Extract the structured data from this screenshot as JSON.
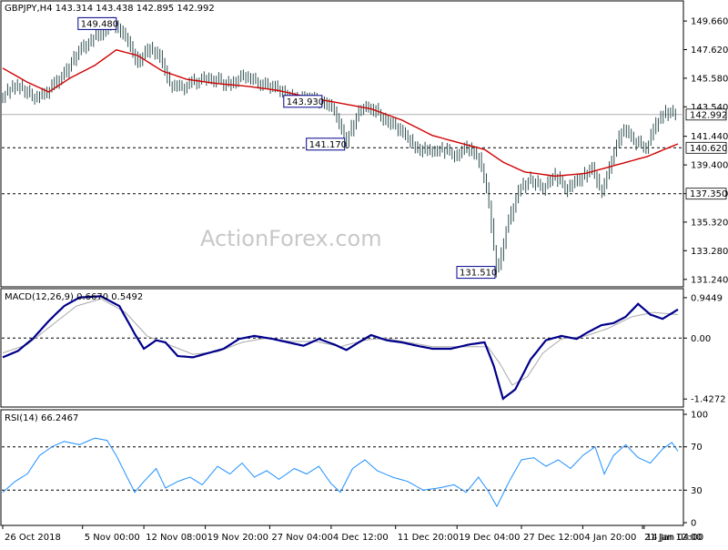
{
  "header": {
    "symbol_line": "GBPJPY,H4  143.314 143.438 142.895 142.992",
    "watermark": "ActionForex.com"
  },
  "chart_data": [
    {
      "type": "candlestick",
      "panel": "price",
      "title": "GBPJPY,H4  143.314 143.438 142.895 142.992",
      "ylim": [
        130.9,
        150.9
      ],
      "y_ticks": [
        "149.660",
        "147.620",
        "145.580",
        "143.540",
        "141.440",
        "139.400",
        "137.350",
        "135.320",
        "133.280",
        "131.240"
      ],
      "last_price_label": "142.992",
      "price_path": [
        {
          "t": 0,
          "v": 144.4
        },
        {
          "t": 5,
          "v": 145.1
        },
        {
          "t": 10,
          "v": 144.2
        },
        {
          "t": 15,
          "v": 144.7
        },
        {
          "t": 20,
          "v": 145.9
        },
        {
          "t": 25,
          "v": 147.6
        },
        {
          "t": 29,
          "v": 148.4
        },
        {
          "t": 33,
          "v": 149.0
        },
        {
          "t": 37,
          "v": 149.48
        },
        {
          "t": 41,
          "v": 148.2
        },
        {
          "t": 44,
          "v": 146.6
        },
        {
          "t": 48,
          "v": 147.8
        },
        {
          "t": 51,
          "v": 147.2
        },
        {
          "t": 54,
          "v": 145.2
        },
        {
          "t": 58,
          "v": 144.9
        },
        {
          "t": 63,
          "v": 145.4
        },
        {
          "t": 68,
          "v": 145.6
        },
        {
          "t": 73,
          "v": 145.1
        },
        {
          "t": 78,
          "v": 145.7
        },
        {
          "t": 83,
          "v": 145.3
        },
        {
          "t": 88,
          "v": 145.0
        },
        {
          "t": 92,
          "v": 144.6
        },
        {
          "t": 96,
          "v": 143.9
        },
        {
          "t": 100,
          "v": 144.3
        },
        {
          "t": 104,
          "v": 143.93
        },
        {
          "t": 108,
          "v": 143.2
        },
        {
          "t": 112,
          "v": 141.17
        },
        {
          "t": 116,
          "v": 143.3
        },
        {
          "t": 120,
          "v": 143.5
        },
        {
          "t": 124,
          "v": 142.8
        },
        {
          "t": 128,
          "v": 142.1
        },
        {
          "t": 133,
          "v": 141.0
        },
        {
          "t": 138,
          "v": 140.3
        },
        {
          "t": 143,
          "v": 140.5
        },
        {
          "t": 148,
          "v": 140.0
        },
        {
          "t": 152,
          "v": 140.7
        },
        {
          "t": 155,
          "v": 139.9
        },
        {
          "t": 158,
          "v": 137.4
        },
        {
          "t": 161,
          "v": 131.51
        },
        {
          "t": 164,
          "v": 134.8
        },
        {
          "t": 168,
          "v": 137.6
        },
        {
          "t": 172,
          "v": 138.4
        },
        {
          "t": 176,
          "v": 137.8
        },
        {
          "t": 180,
          "v": 138.6
        },
        {
          "t": 184,
          "v": 137.7
        },
        {
          "t": 188,
          "v": 138.4
        },
        {
          "t": 192,
          "v": 139.2
        },
        {
          "t": 195,
          "v": 137.5
        },
        {
          "t": 199,
          "v": 140.2
        },
        {
          "t": 202,
          "v": 142.0
        },
        {
          "t": 206,
          "v": 141.0
        },
        {
          "t": 210,
          "v": 140.7
        },
        {
          "t": 213,
          "v": 142.4
        },
        {
          "t": 217,
          "v": 143.3
        },
        {
          "t": 220,
          "v": 142.99
        }
      ],
      "ma_path": [
        {
          "t": 0,
          "v": 146.3
        },
        {
          "t": 8,
          "v": 145.3
        },
        {
          "t": 15,
          "v": 144.6
        },
        {
          "t": 22,
          "v": 145.6
        },
        {
          "t": 30,
          "v": 146.5
        },
        {
          "t": 37,
          "v": 147.6
        },
        {
          "t": 44,
          "v": 147.2
        },
        {
          "t": 52,
          "v": 146.1
        },
        {
          "t": 60,
          "v": 145.5
        },
        {
          "t": 70,
          "v": 145.2
        },
        {
          "t": 80,
          "v": 145.0
        },
        {
          "t": 90,
          "v": 144.7
        },
        {
          "t": 100,
          "v": 144.2
        },
        {
          "t": 110,
          "v": 143.8
        },
        {
          "t": 120,
          "v": 143.4
        },
        {
          "t": 130,
          "v": 142.6
        },
        {
          "t": 140,
          "v": 141.5
        },
        {
          "t": 150,
          "v": 140.9
        },
        {
          "t": 157,
          "v": 140.5
        },
        {
          "t": 163,
          "v": 139.6
        },
        {
          "t": 170,
          "v": 138.9
        },
        {
          "t": 180,
          "v": 138.6
        },
        {
          "t": 190,
          "v": 138.8
        },
        {
          "t": 200,
          "v": 139.4
        },
        {
          "t": 210,
          "v": 140.0
        },
        {
          "t": 220,
          "v": 140.9
        }
      ],
      "h_levels": [
        {
          "label": "140.620",
          "value": 140.62,
          "style": "dashed",
          "boxed": true
        },
        {
          "label": "137.350",
          "value": 137.35,
          "style": "dashed",
          "boxed": true
        },
        {
          "label": "",
          "value": 142.99,
          "style": "solid-light",
          "boxed": false
        }
      ],
      "annotations": [
        {
          "label": "149.480",
          "t": 37,
          "v": 149.48,
          "place": "left"
        },
        {
          "label": "143.930",
          "t": 104,
          "v": 143.93,
          "place": "left"
        },
        {
          "label": "141.170",
          "t": 112,
          "v": 141.17,
          "place": "left-below"
        },
        {
          "label": "131.510",
          "t": 161,
          "v": 131.51,
          "place": "left-below"
        }
      ]
    },
    {
      "type": "line",
      "panel": "macd",
      "title": "MACD(12,26,9) 0.6670 0.5492",
      "ylim": [
        -1.55,
        1.05
      ],
      "y_ticks": [
        "0.9449",
        "0.00",
        "-1.4272"
      ],
      "macd_path": [
        {
          "t": 0,
          "v": -0.45
        },
        {
          "t": 5,
          "v": -0.3
        },
        {
          "t": 10,
          "v": 0.0
        },
        {
          "t": 15,
          "v": 0.4
        },
        {
          "t": 20,
          "v": 0.75
        },
        {
          "t": 25,
          "v": 0.95
        },
        {
          "t": 32,
          "v": 0.98
        },
        {
          "t": 38,
          "v": 0.75
        },
        {
          "t": 43,
          "v": 0.1
        },
        {
          "t": 46,
          "v": -0.25
        },
        {
          "t": 50,
          "v": -0.05
        },
        {
          "t": 53,
          "v": -0.1
        },
        {
          "t": 57,
          "v": -0.42
        },
        {
          "t": 62,
          "v": -0.45
        },
        {
          "t": 67,
          "v": -0.35
        },
        {
          "t": 72,
          "v": -0.25
        },
        {
          "t": 77,
          "v": -0.02
        },
        {
          "t": 82,
          "v": 0.05
        },
        {
          "t": 88,
          "v": -0.02
        },
        {
          "t": 93,
          "v": -0.1
        },
        {
          "t": 98,
          "v": -0.18
        },
        {
          "t": 103,
          "v": -0.02
        },
        {
          "t": 108,
          "v": -0.15
        },
        {
          "t": 112,
          "v": -0.28
        },
        {
          "t": 116,
          "v": -0.1
        },
        {
          "t": 120,
          "v": 0.07
        },
        {
          "t": 125,
          "v": -0.05
        },
        {
          "t": 130,
          "v": -0.1
        },
        {
          "t": 135,
          "v": -0.18
        },
        {
          "t": 140,
          "v": -0.25
        },
        {
          "t": 146,
          "v": -0.25
        },
        {
          "t": 152,
          "v": -0.15
        },
        {
          "t": 157,
          "v": -0.1
        },
        {
          "t": 160,
          "v": -0.65
        },
        {
          "t": 163,
          "v": -1.42
        },
        {
          "t": 167,
          "v": -1.2
        },
        {
          "t": 172,
          "v": -0.5
        },
        {
          "t": 177,
          "v": -0.05
        },
        {
          "t": 182,
          "v": 0.05
        },
        {
          "t": 187,
          "v": -0.02
        },
        {
          "t": 191,
          "v": 0.15
        },
        {
          "t": 195,
          "v": 0.3
        },
        {
          "t": 199,
          "v": 0.35
        },
        {
          "t": 203,
          "v": 0.5
        },
        {
          "t": 207,
          "v": 0.8
        },
        {
          "t": 211,
          "v": 0.55
        },
        {
          "t": 215,
          "v": 0.45
        },
        {
          "t": 220,
          "v": 0.67
        }
      ],
      "signal_path": [
        {
          "t": 0,
          "v": -0.35
        },
        {
          "t": 8,
          "v": -0.15
        },
        {
          "t": 16,
          "v": 0.3
        },
        {
          "t": 24,
          "v": 0.75
        },
        {
          "t": 32,
          "v": 0.92
        },
        {
          "t": 40,
          "v": 0.6
        },
        {
          "t": 47,
          "v": 0.05
        },
        {
          "t": 54,
          "v": -0.15
        },
        {
          "t": 62,
          "v": -0.38
        },
        {
          "t": 70,
          "v": -0.32
        },
        {
          "t": 78,
          "v": -0.1
        },
        {
          "t": 86,
          "v": 0.0
        },
        {
          "t": 94,
          "v": -0.08
        },
        {
          "t": 102,
          "v": -0.08
        },
        {
          "t": 110,
          "v": -0.2
        },
        {
          "t": 118,
          "v": -0.05
        },
        {
          "t": 124,
          "v": 0.0
        },
        {
          "t": 132,
          "v": -0.1
        },
        {
          "t": 140,
          "v": -0.2
        },
        {
          "t": 150,
          "v": -0.2
        },
        {
          "t": 158,
          "v": -0.2
        },
        {
          "t": 162,
          "v": -0.6
        },
        {
          "t": 166,
          "v": -1.1
        },
        {
          "t": 171,
          "v": -0.9
        },
        {
          "t": 176,
          "v": -0.35
        },
        {
          "t": 182,
          "v": -0.02
        },
        {
          "t": 190,
          "v": 0.05
        },
        {
          "t": 197,
          "v": 0.22
        },
        {
          "t": 205,
          "v": 0.5
        },
        {
          "t": 212,
          "v": 0.6
        },
        {
          "t": 220,
          "v": 0.55
        }
      ]
    },
    {
      "type": "line",
      "panel": "rsi",
      "title": "RSI(14) 66.2467",
      "ylim": [
        0,
        100
      ],
      "y_ticks": [
        "100",
        "70",
        "30",
        "0"
      ],
      "levels": [
        70,
        30
      ],
      "rsi_path": [
        {
          "t": 0,
          "v": 28
        },
        {
          "t": 4,
          "v": 38
        },
        {
          "t": 8,
          "v": 45
        },
        {
          "t": 12,
          "v": 62
        },
        {
          "t": 16,
          "v": 70
        },
        {
          "t": 20,
          "v": 75
        },
        {
          "t": 25,
          "v": 72
        },
        {
          "t": 30,
          "v": 78
        },
        {
          "t": 34,
          "v": 76
        },
        {
          "t": 37,
          "v": 62
        },
        {
          "t": 40,
          "v": 45
        },
        {
          "t": 43,
          "v": 28
        },
        {
          "t": 46,
          "v": 38
        },
        {
          "t": 50,
          "v": 50
        },
        {
          "t": 53,
          "v": 32
        },
        {
          "t": 57,
          "v": 38
        },
        {
          "t": 61,
          "v": 42
        },
        {
          "t": 65,
          "v": 35
        },
        {
          "t": 70,
          "v": 52
        },
        {
          "t": 74,
          "v": 45
        },
        {
          "t": 78,
          "v": 55
        },
        {
          "t": 82,
          "v": 42
        },
        {
          "t": 86,
          "v": 48
        },
        {
          "t": 90,
          "v": 40
        },
        {
          "t": 95,
          "v": 50
        },
        {
          "t": 99,
          "v": 45
        },
        {
          "t": 103,
          "v": 52
        },
        {
          "t": 107,
          "v": 36
        },
        {
          "t": 110,
          "v": 28
        },
        {
          "t": 114,
          "v": 50
        },
        {
          "t": 118,
          "v": 58
        },
        {
          "t": 122,
          "v": 48
        },
        {
          "t": 127,
          "v": 42
        },
        {
          "t": 132,
          "v": 38
        },
        {
          "t": 137,
          "v": 30
        },
        {
          "t": 142,
          "v": 32
        },
        {
          "t": 147,
          "v": 35
        },
        {
          "t": 151,
          "v": 28
        },
        {
          "t": 155,
          "v": 42
        },
        {
          "t": 158,
          "v": 30
        },
        {
          "t": 161,
          "v": 15
        },
        {
          "t": 165,
          "v": 38
        },
        {
          "t": 169,
          "v": 58
        },
        {
          "t": 173,
          "v": 60
        },
        {
          "t": 177,
          "v": 52
        },
        {
          "t": 181,
          "v": 58
        },
        {
          "t": 185,
          "v": 50
        },
        {
          "t": 189,
          "v": 62
        },
        {
          "t": 193,
          "v": 70
        },
        {
          "t": 196,
          "v": 45
        },
        {
          "t": 199,
          "v": 62
        },
        {
          "t": 203,
          "v": 72
        },
        {
          "t": 207,
          "v": 60
        },
        {
          "t": 211,
          "v": 55
        },
        {
          "t": 215,
          "v": 68
        },
        {
          "t": 218,
          "v": 74
        },
        {
          "t": 220,
          "v": 66
        }
      ]
    }
  ],
  "x_axis": {
    "t_max": 220,
    "labels": [
      {
        "t": 0,
        "text": "26 Oct 2018"
      },
      {
        "t": 26,
        "text": "5 Nov 00:00"
      },
      {
        "t": 46,
        "text": "12 Nov 08:00"
      },
      {
        "t": 66,
        "text": "19 Nov 20:00"
      },
      {
        "t": 87,
        "text": "27 Nov 04:00"
      },
      {
        "t": 107,
        "text": "4 Dec 12:00"
      },
      {
        "t": 128,
        "text": "11 Dec 20:00"
      },
      {
        "t": 148,
        "text": "19 Dec 04:00"
      },
      {
        "t": 169,
        "text": "27 Dec 12:00"
      },
      {
        "t": 189,
        "text": "4 Jan 20:00"
      },
      {
        "t": 209,
        "text": "14 Jan 04:00"
      },
      {
        "t": 227,
        "text": "21 Jan 12:00"
      }
    ]
  },
  "colors": {
    "candle": "#2f4f4f",
    "ma": "#d00000",
    "macd": "#00008b",
    "signal": "#a9a9a9",
    "rsi": "#1e90ff",
    "label_box": "#00008b",
    "axis": "#000000",
    "dashed_level": "#000000"
  }
}
